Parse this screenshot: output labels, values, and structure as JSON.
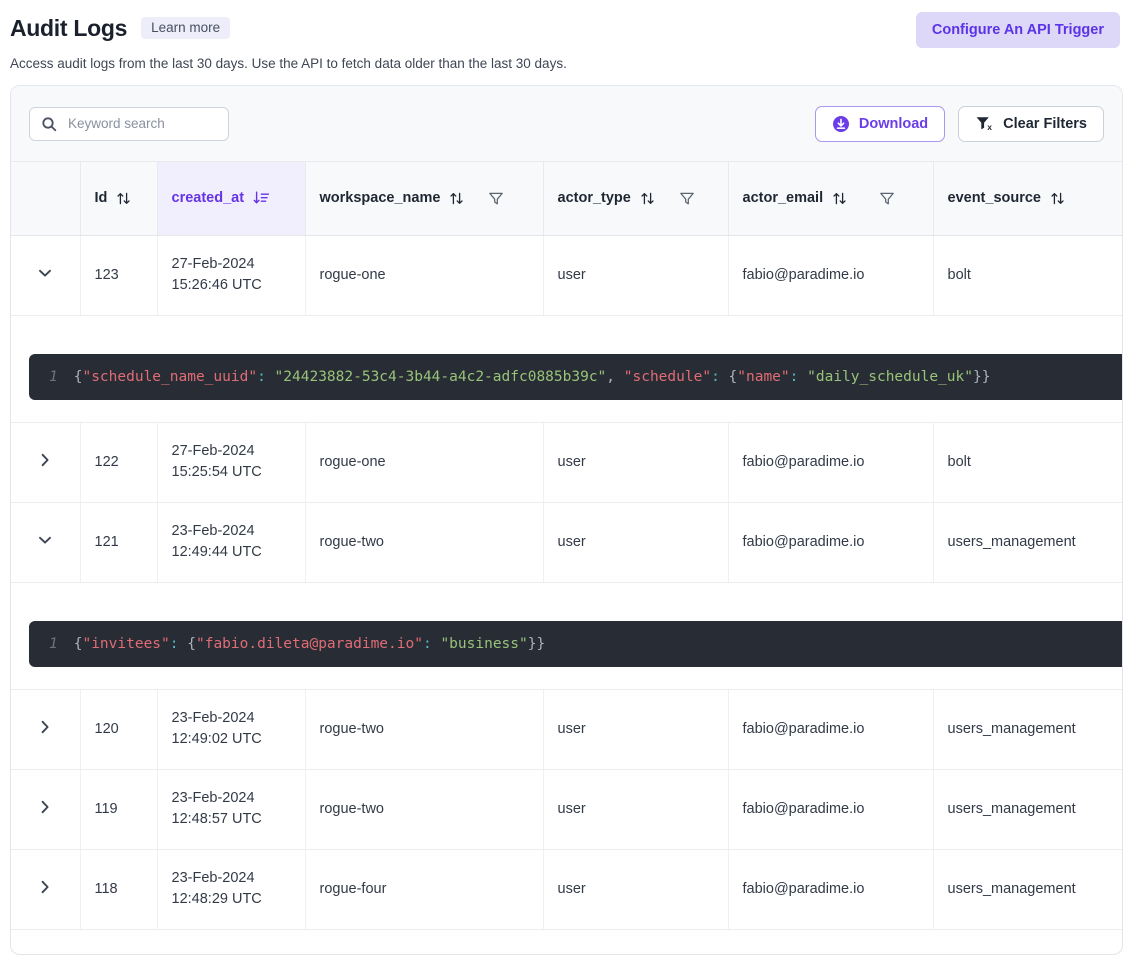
{
  "header": {
    "title": "Audit Logs",
    "learn_more": "Learn more",
    "subtitle": "Access audit logs from the last 30 days. Use the API to fetch data older than the last 30 days.",
    "api_trigger_label": "Configure An API Trigger",
    "accent_color": "#6633e6",
    "api_trigger_bg": "#ddd8f7"
  },
  "toolbar": {
    "search_placeholder": "Keyword search",
    "search_value": "",
    "download_label": "Download",
    "clear_filters_label": "Clear Filters"
  },
  "table": {
    "columns": [
      {
        "key": "expand",
        "label": "",
        "sortable": false,
        "filterable": false,
        "sorted": false
      },
      {
        "key": "id",
        "label": "Id",
        "sortable": true,
        "filterable": false,
        "sorted": false
      },
      {
        "key": "created_at",
        "label": "created_at",
        "sortable": true,
        "filterable": false,
        "sorted": true,
        "sort_dir": "desc"
      },
      {
        "key": "workspace_name",
        "label": "workspace_name",
        "sortable": true,
        "filterable": true,
        "sorted": false
      },
      {
        "key": "actor_type",
        "label": "actor_type",
        "sortable": true,
        "filterable": true,
        "sorted": false
      },
      {
        "key": "actor_email",
        "label": "actor_email",
        "sortable": true,
        "filterable": true,
        "sorted": false
      },
      {
        "key": "event_source",
        "label": "event_source",
        "sortable": true,
        "filterable": true,
        "sorted": false
      }
    ],
    "rows": [
      {
        "expanded": true,
        "id": "123",
        "date": "27-Feb-2024",
        "time": "15:26:46 UTC",
        "workspace_name": "rogue-one",
        "actor_type": "user",
        "actor_email": "fabio@paradime.io",
        "event_source": "bolt",
        "detail": {
          "line_number": "1",
          "text": "{\"schedule_name_uuid\": \"24423882-53c4-3b44-a4c2-adfc0885b39c\", \"schedule\": {\"name\": \"daily_schedule_uk\"}}"
        }
      },
      {
        "expanded": false,
        "id": "122",
        "date": "27-Feb-2024",
        "time": "15:25:54 UTC",
        "workspace_name": "rogue-one",
        "actor_type": "user",
        "actor_email": "fabio@paradime.io",
        "event_source": "bolt"
      },
      {
        "expanded": true,
        "id": "121",
        "date": "23-Feb-2024",
        "time": "12:49:44 UTC",
        "workspace_name": "rogue-two",
        "actor_type": "user",
        "actor_email": "fabio@paradime.io",
        "event_source": "users_management",
        "detail": {
          "line_number": "1",
          "text": "{\"invitees\": {\"fabio.dileta@paradime.io\": \"business\"}}"
        }
      },
      {
        "expanded": false,
        "id": "120",
        "date": "23-Feb-2024",
        "time": "12:49:02 UTC",
        "workspace_name": "rogue-two",
        "actor_type": "user",
        "actor_email": "fabio@paradime.io",
        "event_source": "users_management"
      },
      {
        "expanded": false,
        "id": "119",
        "date": "23-Feb-2024",
        "time": "12:48:57 UTC",
        "workspace_name": "rogue-two",
        "actor_type": "user",
        "actor_email": "fabio@paradime.io",
        "event_source": "users_management"
      },
      {
        "expanded": false,
        "id": "118",
        "date": "23-Feb-2024",
        "time": "12:48:29 UTC",
        "workspace_name": "rogue-four",
        "actor_type": "user",
        "actor_email": "fabio@paradime.io",
        "event_source": "users_management"
      }
    ]
  }
}
